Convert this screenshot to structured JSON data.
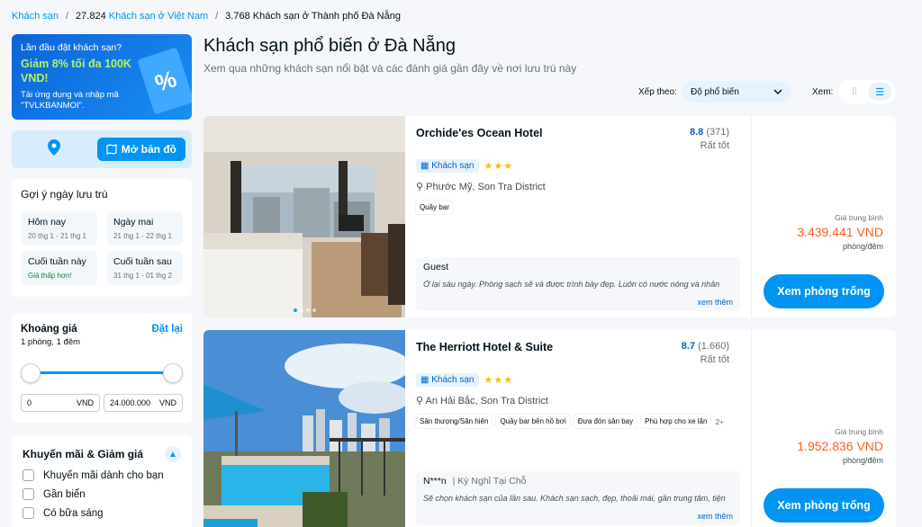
{
  "breadcrumb": {
    "root": "Khách sạn",
    "count1": "27.824",
    "level1": "Khách sạn ở Việt Nam",
    "current": "3.768 Khách sạn ở Thành phố Đà Nẵng"
  },
  "promo": {
    "line1": "Lần đầu đặt khách sạn?",
    "line2": "Giảm 8% tối đa 100K VND!",
    "line3": "Tải ứng dụng và nhập mã \"TVLKBANMOI\"."
  },
  "map": {
    "button_label": "Mở bản đồ"
  },
  "stay": {
    "title": "Gợi ý ngày lưu trú",
    "options": [
      {
        "label": "Hôm nay",
        "dates": "20 thg 1 - 21 thg 1",
        "note_style": ""
      },
      {
        "label": "Ngày mai",
        "dates": "21 thg 1 - 22 thg 1",
        "note_style": ""
      },
      {
        "label": "Cuối tuần này",
        "dates": "Giá thấp hơn!",
        "note_style": "green"
      },
      {
        "label": "Cuối tuần sau",
        "dates": "31 thg 1 - 01 thg 2",
        "note_style": ""
      }
    ]
  },
  "price_filter": {
    "title": "Khoảng giá",
    "reset": "Đặt lại",
    "sub": "1 phòng, 1 đêm",
    "min": "0",
    "max": "24.000.000",
    "currency": "VND"
  },
  "promo_filter": {
    "title": "Khuyến mãi & Giảm giá",
    "options": [
      "Khuyến mãi dành cho bạn",
      "Gần biển",
      "Có bữa sáng"
    ]
  },
  "main": {
    "title": "Khách sạn phổ biến ở Đà Nẵng",
    "subtitle": "Xem qua những khách sạn nổi bật và các đánh giá gần đây về nơi lưu trú này",
    "sort_label": "Xếp theo:",
    "sort_value": "Độ phổ biến",
    "view_label": "Xem:"
  },
  "hotels": [
    {
      "name": "Orchide'es Ocean Hotel",
      "score": "8.8",
      "reviews": "(371)",
      "score_word": "Rất tốt",
      "type": "Khách sạn",
      "stars": "★★★",
      "location": "Phước Mỹ, Son Tra District",
      "tags": [
        "Quầy bar"
      ],
      "more": "",
      "review_author": "Guest",
      "review_source": "",
      "review_text": "Ở lại sáu ngày. Phòng sạch sẽ và được trình bày đẹp. Luôn có nước nóng và nhân",
      "see_more": "xem thêm",
      "price_label": "Giá trung bình",
      "price": "3.439.441 VND",
      "unit": "phòng/đêm",
      "cta": "Xem phòng trống"
    },
    {
      "name": "The Herriott Hotel & Suite",
      "score": "8.7",
      "reviews": "(1.660)",
      "score_word": "Rất tốt",
      "type": "Khách sạn",
      "stars": "★★★",
      "location": "An Hải Bắc, Son Tra District",
      "tags": [
        "Sân thượng/Sân hiên",
        "Quầy bar bên hồ bơi",
        "Đưa đón sân bay",
        "Phù hợp cho xe lăn"
      ],
      "more": "2+",
      "review_author": "N***n",
      "review_source": "| Kỳ Nghỉ Tại Chỗ",
      "review_text": "Sẽ chọn khách sạn của lần sau. Khách sạn sạch, đẹp, thoải mái, gần trung tâm, tiện",
      "see_more": "xem thêm",
      "price_label": "Giá trung bình",
      "price": "1.952.836 VND",
      "unit": "phòng/đêm",
      "cta": "Xem phòng trống"
    }
  ]
}
